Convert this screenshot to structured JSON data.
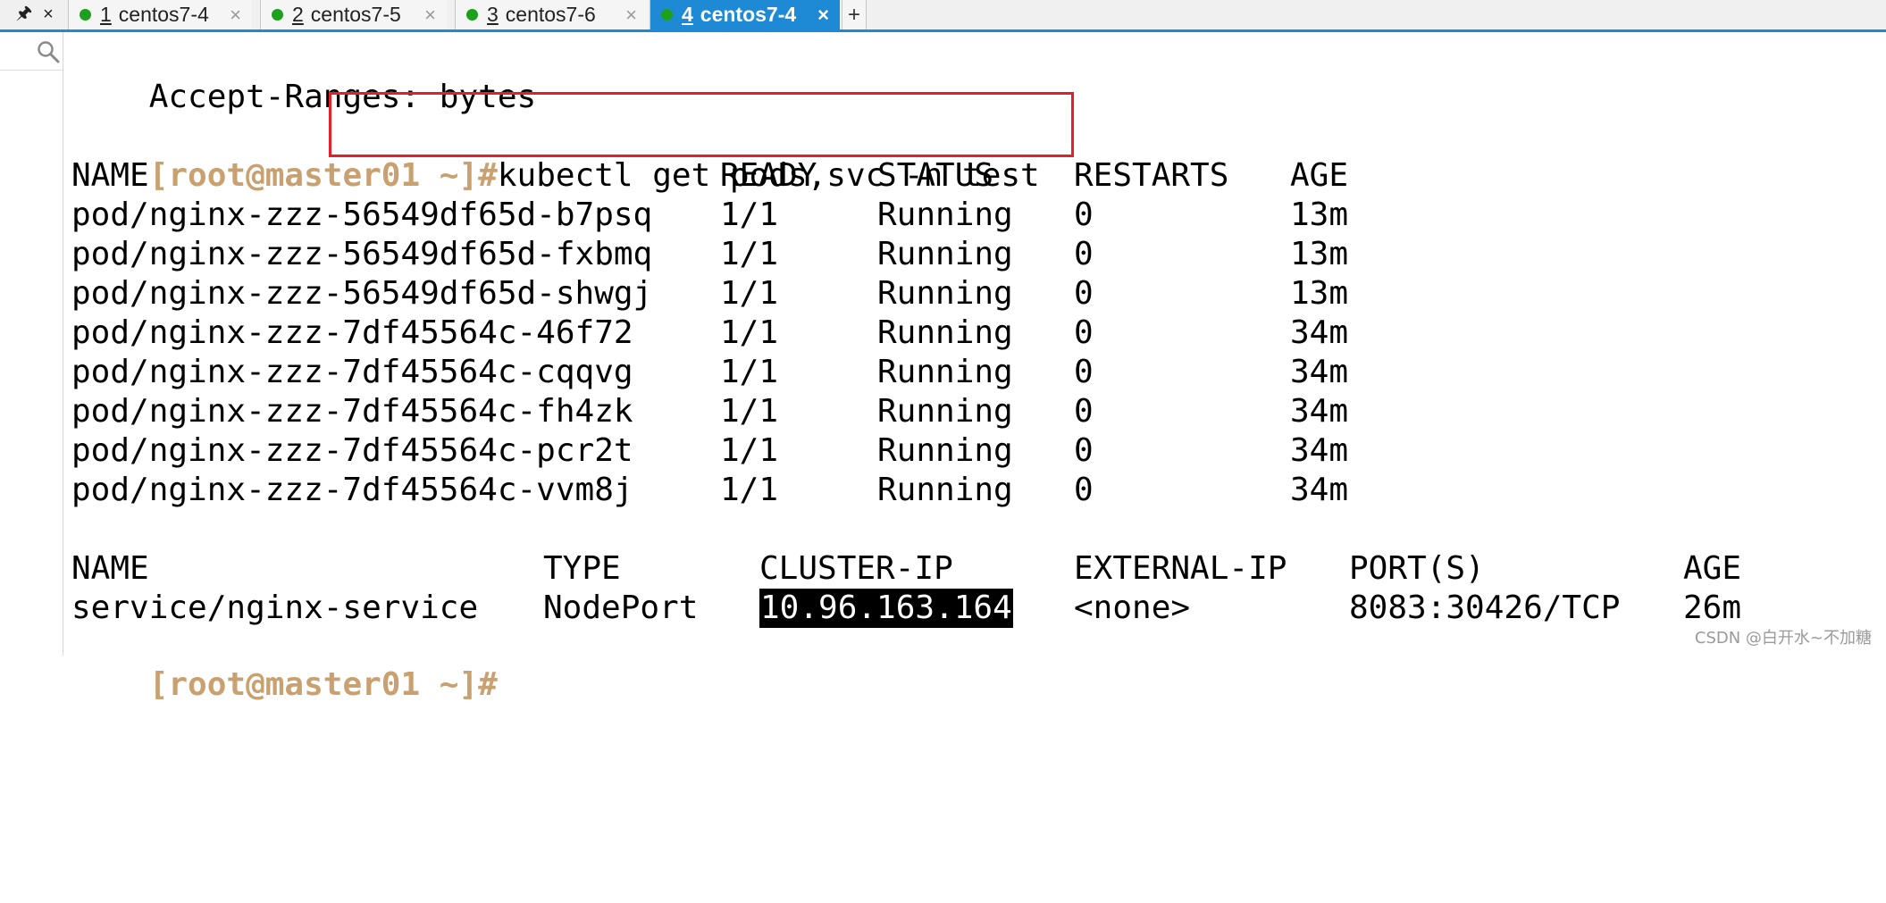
{
  "tabs": [
    {
      "num": "1",
      "label": "centos7-4",
      "active": false
    },
    {
      "num": "2",
      "label": "centos7-5",
      "active": false
    },
    {
      "num": "3",
      "label": "centos7-6",
      "active": false
    },
    {
      "num": "4",
      "label": "centos7-4",
      "active": true
    }
  ],
  "tabbar": {
    "pin": "🖈",
    "close_all": "×",
    "close": "×",
    "new_tab": "+"
  },
  "terminal": {
    "accept_line": "Accept-Ranges: bytes",
    "prompt": "[root@master01 ~]#",
    "command": "kubectl get pods,svc -n test",
    "pods_header": {
      "name": "NAME",
      "ready": "READY",
      "status": "STATUS",
      "restarts": "RESTARTS",
      "age": "AGE"
    },
    "pods": [
      {
        "name": "pod/nginx-zzz-56549df65d-b7psq",
        "ready": "1/1",
        "status": "Running",
        "restarts": "0",
        "age": "13m"
      },
      {
        "name": "pod/nginx-zzz-56549df65d-fxbmq",
        "ready": "1/1",
        "status": "Running",
        "restarts": "0",
        "age": "13m"
      },
      {
        "name": "pod/nginx-zzz-56549df65d-shwgj",
        "ready": "1/1",
        "status": "Running",
        "restarts": "0",
        "age": "13m"
      },
      {
        "name": "pod/nginx-zzz-7df45564c-46f72",
        "ready": "1/1",
        "status": "Running",
        "restarts": "0",
        "age": "34m"
      },
      {
        "name": "pod/nginx-zzz-7df45564c-cqqvg",
        "ready": "1/1",
        "status": "Running",
        "restarts": "0",
        "age": "34m"
      },
      {
        "name": "pod/nginx-zzz-7df45564c-fh4zk",
        "ready": "1/1",
        "status": "Running",
        "restarts": "0",
        "age": "34m"
      },
      {
        "name": "pod/nginx-zzz-7df45564c-pcr2t",
        "ready": "1/1",
        "status": "Running",
        "restarts": "0",
        "age": "34m"
      },
      {
        "name": "pod/nginx-zzz-7df45564c-vvm8j",
        "ready": "1/1",
        "status": "Running",
        "restarts": "0",
        "age": "34m"
      }
    ],
    "svc_header": {
      "name": "NAME",
      "type": "TYPE",
      "cluster_ip": "CLUSTER-IP",
      "external_ip": "EXTERNAL-IP",
      "ports": "PORT(S)",
      "age": "AGE"
    },
    "service": {
      "name": "service/nginx-service",
      "type": "NodePort",
      "cluster_ip": "10.96.163.164",
      "external_ip": "<none>",
      "ports": "8083:30426/TCP",
      "age": "26m"
    },
    "final_prompt": "[root@master01 ~]#"
  },
  "watermark": "CSDN @白开水~不加糖",
  "colors": {
    "prompt": "#c9a070",
    "active_tab": "#1e8ad6",
    "status_dot": "#1da01d",
    "annotation_box": "#e3202a"
  }
}
